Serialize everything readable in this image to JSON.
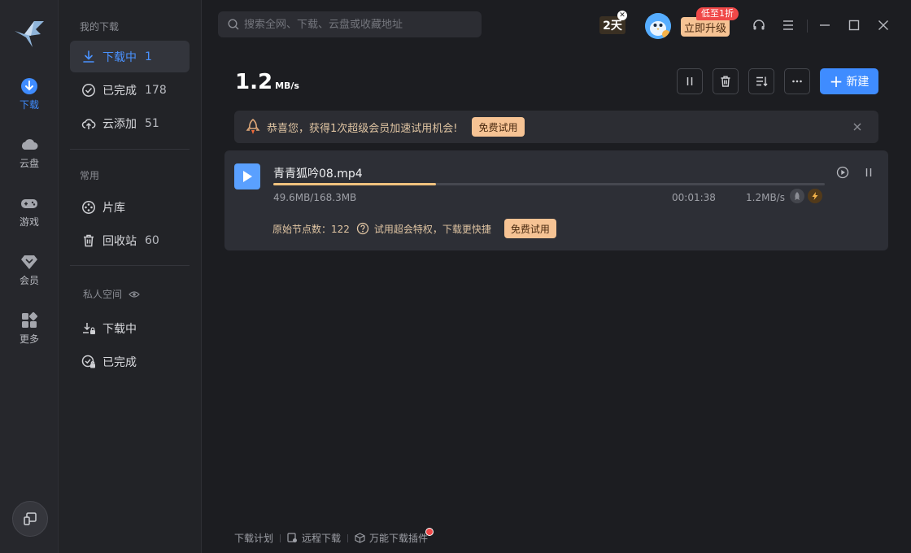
{
  "rail": {
    "items": [
      {
        "label": "下载"
      },
      {
        "label": "云盘"
      },
      {
        "label": "游戏"
      },
      {
        "label": "会员"
      },
      {
        "label": "更多"
      }
    ],
    "accent": "#3f8cff"
  },
  "sidebar": {
    "section_my_downloads": "我的下载",
    "items": [
      {
        "label": "下载中",
        "count": "1"
      },
      {
        "label": "已完成",
        "count": "178"
      },
      {
        "label": "云添加",
        "count": "51"
      }
    ],
    "section_common": "常用",
    "common_items": [
      {
        "label": "片库",
        "count": ""
      },
      {
        "label": "回收站",
        "count": "60"
      }
    ],
    "section_private": "私人空间",
    "private_items": [
      {
        "label": "下载中"
      },
      {
        "label": "已完成"
      }
    ]
  },
  "topbar": {
    "search_placeholder": "搜索全网、下载、云盘或收藏地址",
    "days_badge": "2天",
    "upgrade_label": "立即升级",
    "promo_tag": "低至1折"
  },
  "toolbar": {
    "speed_value": "1.2",
    "speed_unit": "MB/s",
    "new_label": "新建"
  },
  "banner": {
    "text": "恭喜您，获得1次超级会员加速试用机会!",
    "trial_label": "免费试用"
  },
  "task": {
    "filename": "青青狐吟08.mp4",
    "progress_fraction": 0.295,
    "size_text": "49.6MB/168.3MB",
    "eta": "00:01:38",
    "speed": "1.2MB/s",
    "nodes_text": "原始节点数：122",
    "promo_text": "试用超会特权，下载更快捷",
    "trial_label": "免费试用"
  },
  "footer": {
    "links": [
      "下载计划",
      "远程下载",
      "万能下载插件"
    ]
  }
}
